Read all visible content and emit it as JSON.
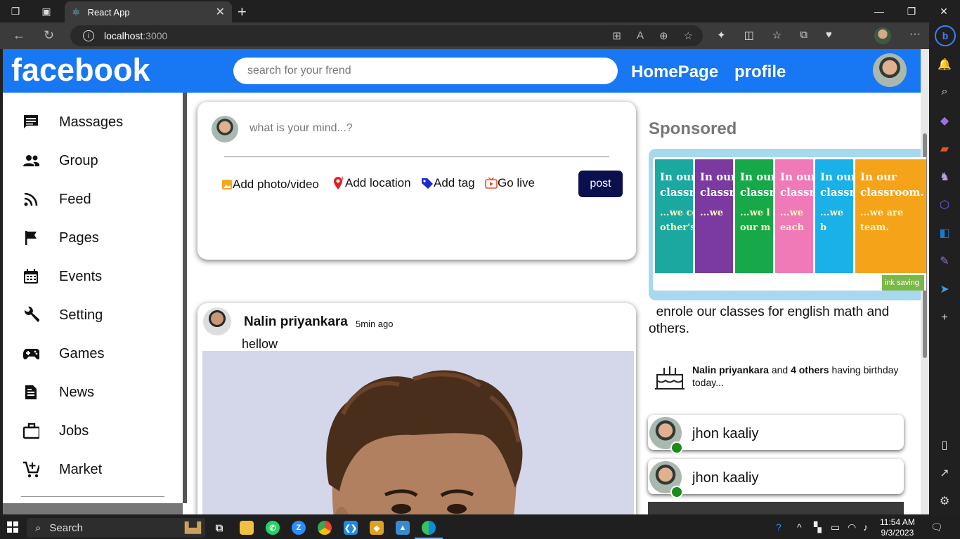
{
  "browser": {
    "tab_title": "React App",
    "url_host": "localhost",
    "url_port": ":3000"
  },
  "header": {
    "logo": "facebook",
    "search_placeholder": "search for your frend",
    "nav": [
      "HomePage",
      "profile"
    ]
  },
  "sidebar": {
    "items": [
      {
        "label": "Massages",
        "icon": "message-icon"
      },
      {
        "label": "Group",
        "icon": "group-icon"
      },
      {
        "label": "Feed",
        "icon": "rss-feed-icon"
      },
      {
        "label": "Pages",
        "icon": "flag-icon"
      },
      {
        "label": "Events",
        "icon": "calendar-icon"
      },
      {
        "label": "Setting",
        "icon": "wrench-icon"
      },
      {
        "label": "Games",
        "icon": "gamepad-icon"
      },
      {
        "label": "News",
        "icon": "article-icon"
      },
      {
        "label": "Jobs",
        "icon": "briefcase-icon"
      },
      {
        "label": "Market",
        "icon": "cart-icon"
      }
    ]
  },
  "composer": {
    "placeholder": "what is your mind...?",
    "options": [
      {
        "label": "Add photo/video",
        "icon": "photo-icon",
        "color": "#f5a623"
      },
      {
        "label": "Add location",
        "icon": "location-pin-icon",
        "color": "#e02020"
      },
      {
        "label": "Add tag",
        "icon": "tag-icon",
        "color": "#1a2ad0"
      },
      {
        "label": "Go live",
        "icon": "live-tv-icon",
        "color": "#e2542a"
      }
    ],
    "post_label": "post"
  },
  "post": {
    "author": "Nalin priyankara",
    "time": "5min ago",
    "text": "hellow"
  },
  "right": {
    "sponsored": "Sponsored",
    "ad_cards": [
      {
        "line1": "In our",
        "line2": "classr",
        "line3": "...we cel",
        "line4": "other's",
        "color": "#1aa8a0"
      },
      {
        "line1": "In our",
        "line2": "classr",
        "line3": "...we",
        "line4": "",
        "color": "#7a3aa0"
      },
      {
        "line1": "In our",
        "line2": "classr",
        "line3": "...we l",
        "line4": "our m",
        "color": "#17a84a"
      },
      {
        "line1": "In our",
        "line2": "classr",
        "line3": "...we",
        "line4": "each",
        "color": "#f07ab8"
      },
      {
        "line1": "In our",
        "line2": "classr",
        "line3": "...we",
        "line4": "b",
        "color": "#1ab0e8"
      },
      {
        "line1": "In our",
        "line2": "classroom.",
        "line3": "...we are",
        "line4": "team.",
        "color": "#f5a41a"
      }
    ],
    "ad_badge": "ink saving",
    "ad_description": "enrole our classes for english math and others.",
    "birthday": {
      "name": "Nalin priyankara",
      "and": "and",
      "others": "4 others",
      "rest": "having birthday today..."
    },
    "contacts": [
      {
        "name": "jhon kaaliy"
      },
      {
        "name": "jhon kaaliy"
      }
    ]
  },
  "taskbar": {
    "search": "Search",
    "time": "11:54 AM",
    "date": "9/3/2023"
  }
}
